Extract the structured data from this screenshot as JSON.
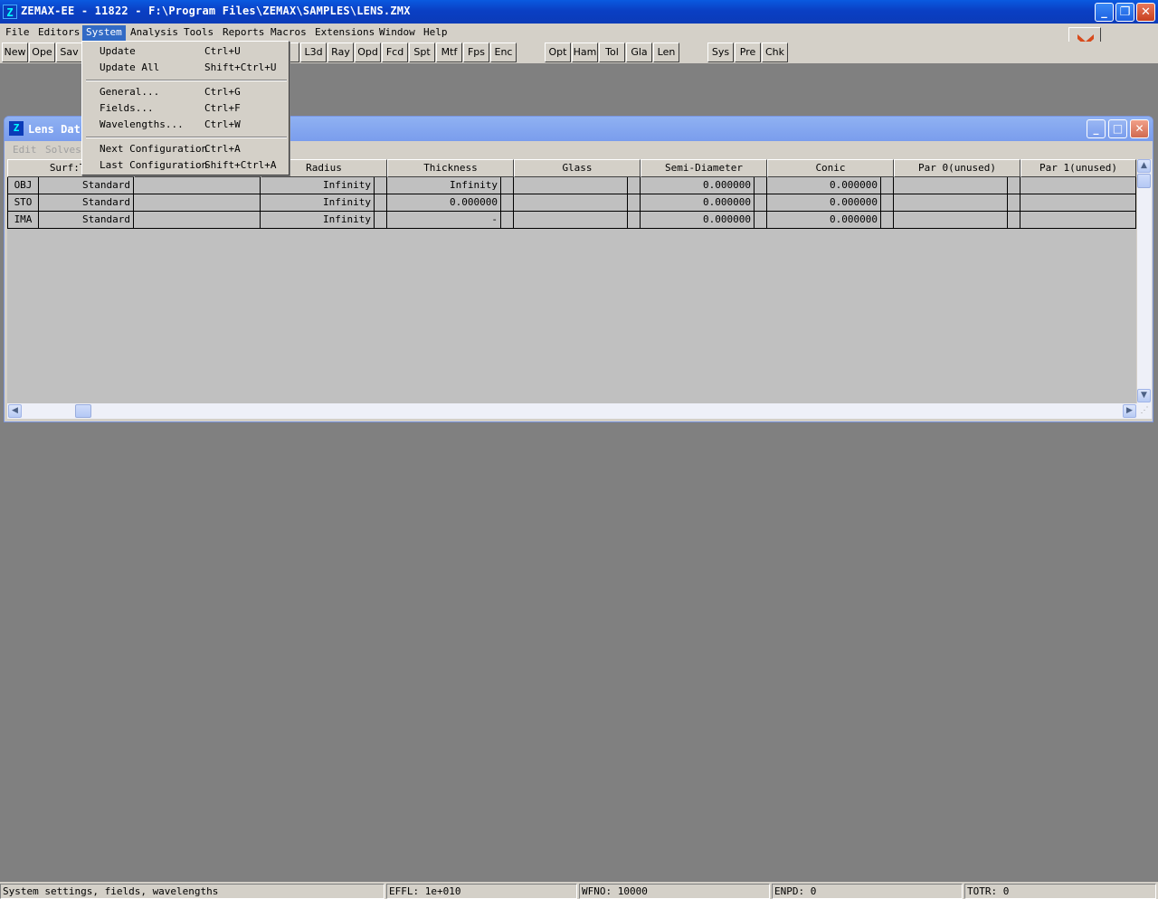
{
  "window": {
    "title": "ZEMAX-EE - 11822 - F:\\Program Files\\ZEMAX\\SAMPLES\\LENS.ZMX",
    "icon": "zemax-app-icon",
    "min_label": "_",
    "restore_label": "❐",
    "close_label": "✕"
  },
  "menubar": [
    {
      "label": "File"
    },
    {
      "label": "Editors"
    },
    {
      "label": "System"
    },
    {
      "label": "Analysis"
    },
    {
      "label": "Tools"
    },
    {
      "label": "Reports"
    },
    {
      "label": "Macros"
    },
    {
      "label": "Extensions"
    },
    {
      "label": "Window"
    },
    {
      "label": "Help"
    }
  ],
  "toolbar": {
    "buttons": [
      "New",
      "Ope",
      "Sav",
      "y",
      "L3d",
      "Ray",
      "Opd",
      "Fcd",
      "Spt",
      "Mtf",
      "Fps",
      "Enc",
      "Opt",
      "Ham",
      "Tol",
      "Gla",
      "Len",
      "Sys",
      "Pre",
      "Chk"
    ],
    "expand_icon": "double-chevron-down-icon"
  },
  "system_menu": {
    "items": [
      {
        "label": "Update",
        "shortcut": "Ctrl+U"
      },
      {
        "label": "Update All",
        "shortcut": "Shift+Ctrl+U"
      },
      {
        "label": "General...",
        "shortcut": "Ctrl+G"
      },
      {
        "label": "Fields...",
        "shortcut": "Ctrl+F"
      },
      {
        "label": "Wavelengths...",
        "shortcut": "Ctrl+W"
      },
      {
        "label": "Next Configuration",
        "shortcut": "Ctrl+A"
      },
      {
        "label": "Last Configuration",
        "shortcut": "Shift+Ctrl+A"
      }
    ]
  },
  "lens_window": {
    "title": "Lens Dat",
    "menu": [
      "Edit",
      "Solves"
    ],
    "columns": [
      "Surf:Ty",
      "",
      "Radius",
      "",
      "Thickness",
      "",
      "Glass",
      "",
      "Semi-Diameter",
      "",
      "Conic",
      "",
      "Par 0(unused)",
      "",
      "Par 1(unused)"
    ],
    "rows": [
      {
        "surf": "OBJ",
        "type": "Standard",
        "comment": "",
        "radius": "Infinity",
        "thickness": "Infinity",
        "glass": "",
        "semi_diameter": "0.000000",
        "conic": "0.000000",
        "par0": "",
        "par1": ""
      },
      {
        "surf": "STO",
        "type": "Standard",
        "comment": "",
        "radius": "Infinity",
        "thickness": "0.000000",
        "glass": "",
        "semi_diameter": "0.000000",
        "conic": "0.000000",
        "par0": "",
        "par1": ""
      },
      {
        "surf": "IMA",
        "type": "Standard",
        "comment": "",
        "radius": "Infinity",
        "thickness": "-",
        "glass": "",
        "semi_diameter": "0.000000",
        "conic": "0.000000",
        "par0": "",
        "par1": ""
      }
    ]
  },
  "statusbar": {
    "message": "System settings, fields, wavelengths",
    "effl": "EFFL: 1e+010",
    "wfno": "WFNO: 10000",
    "enpd": "ENPD: 0",
    "totr": "TOTR: 0"
  }
}
